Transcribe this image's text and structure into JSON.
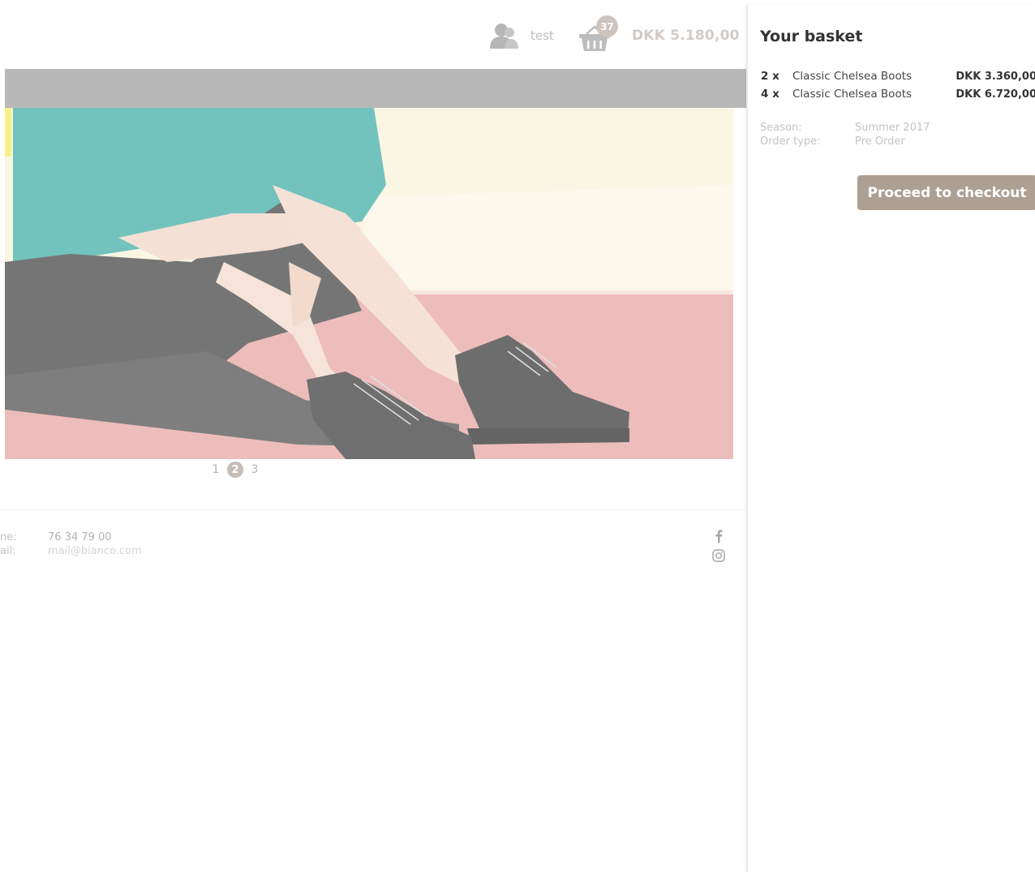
{
  "header": {
    "user_name": "test",
    "basket_count": "37",
    "basket_total": "DKK 5.180,00"
  },
  "pagination": {
    "pages": [
      "1",
      "2",
      "3"
    ],
    "current": "2"
  },
  "footer": {
    "phone_label": "ne:",
    "phone_value": "76 34 79 00",
    "email_label": "ail:",
    "email_value": "mail@bianco.com",
    "social": [
      "facebook-icon",
      "instagram-icon"
    ]
  },
  "basket": {
    "title": "Your basket",
    "lines": [
      {
        "qty": "2 x",
        "name": "Classic Chelsea Boots",
        "price": "DKK 3.360,00"
      },
      {
        "qty": "4 x",
        "name": "Classic Chelsea Boots",
        "price": "DKK 6.720,00"
      }
    ],
    "season_label": "Season:",
    "season_value": "Summer 2017",
    "order_type_label": "Order type:",
    "order_type_value": "Pre Order",
    "checkout_label": "Proceed to checkout"
  },
  "colors": {
    "accent": "#ad9f92",
    "nav_bar": "#929292",
    "badge": "#b3a69a"
  }
}
